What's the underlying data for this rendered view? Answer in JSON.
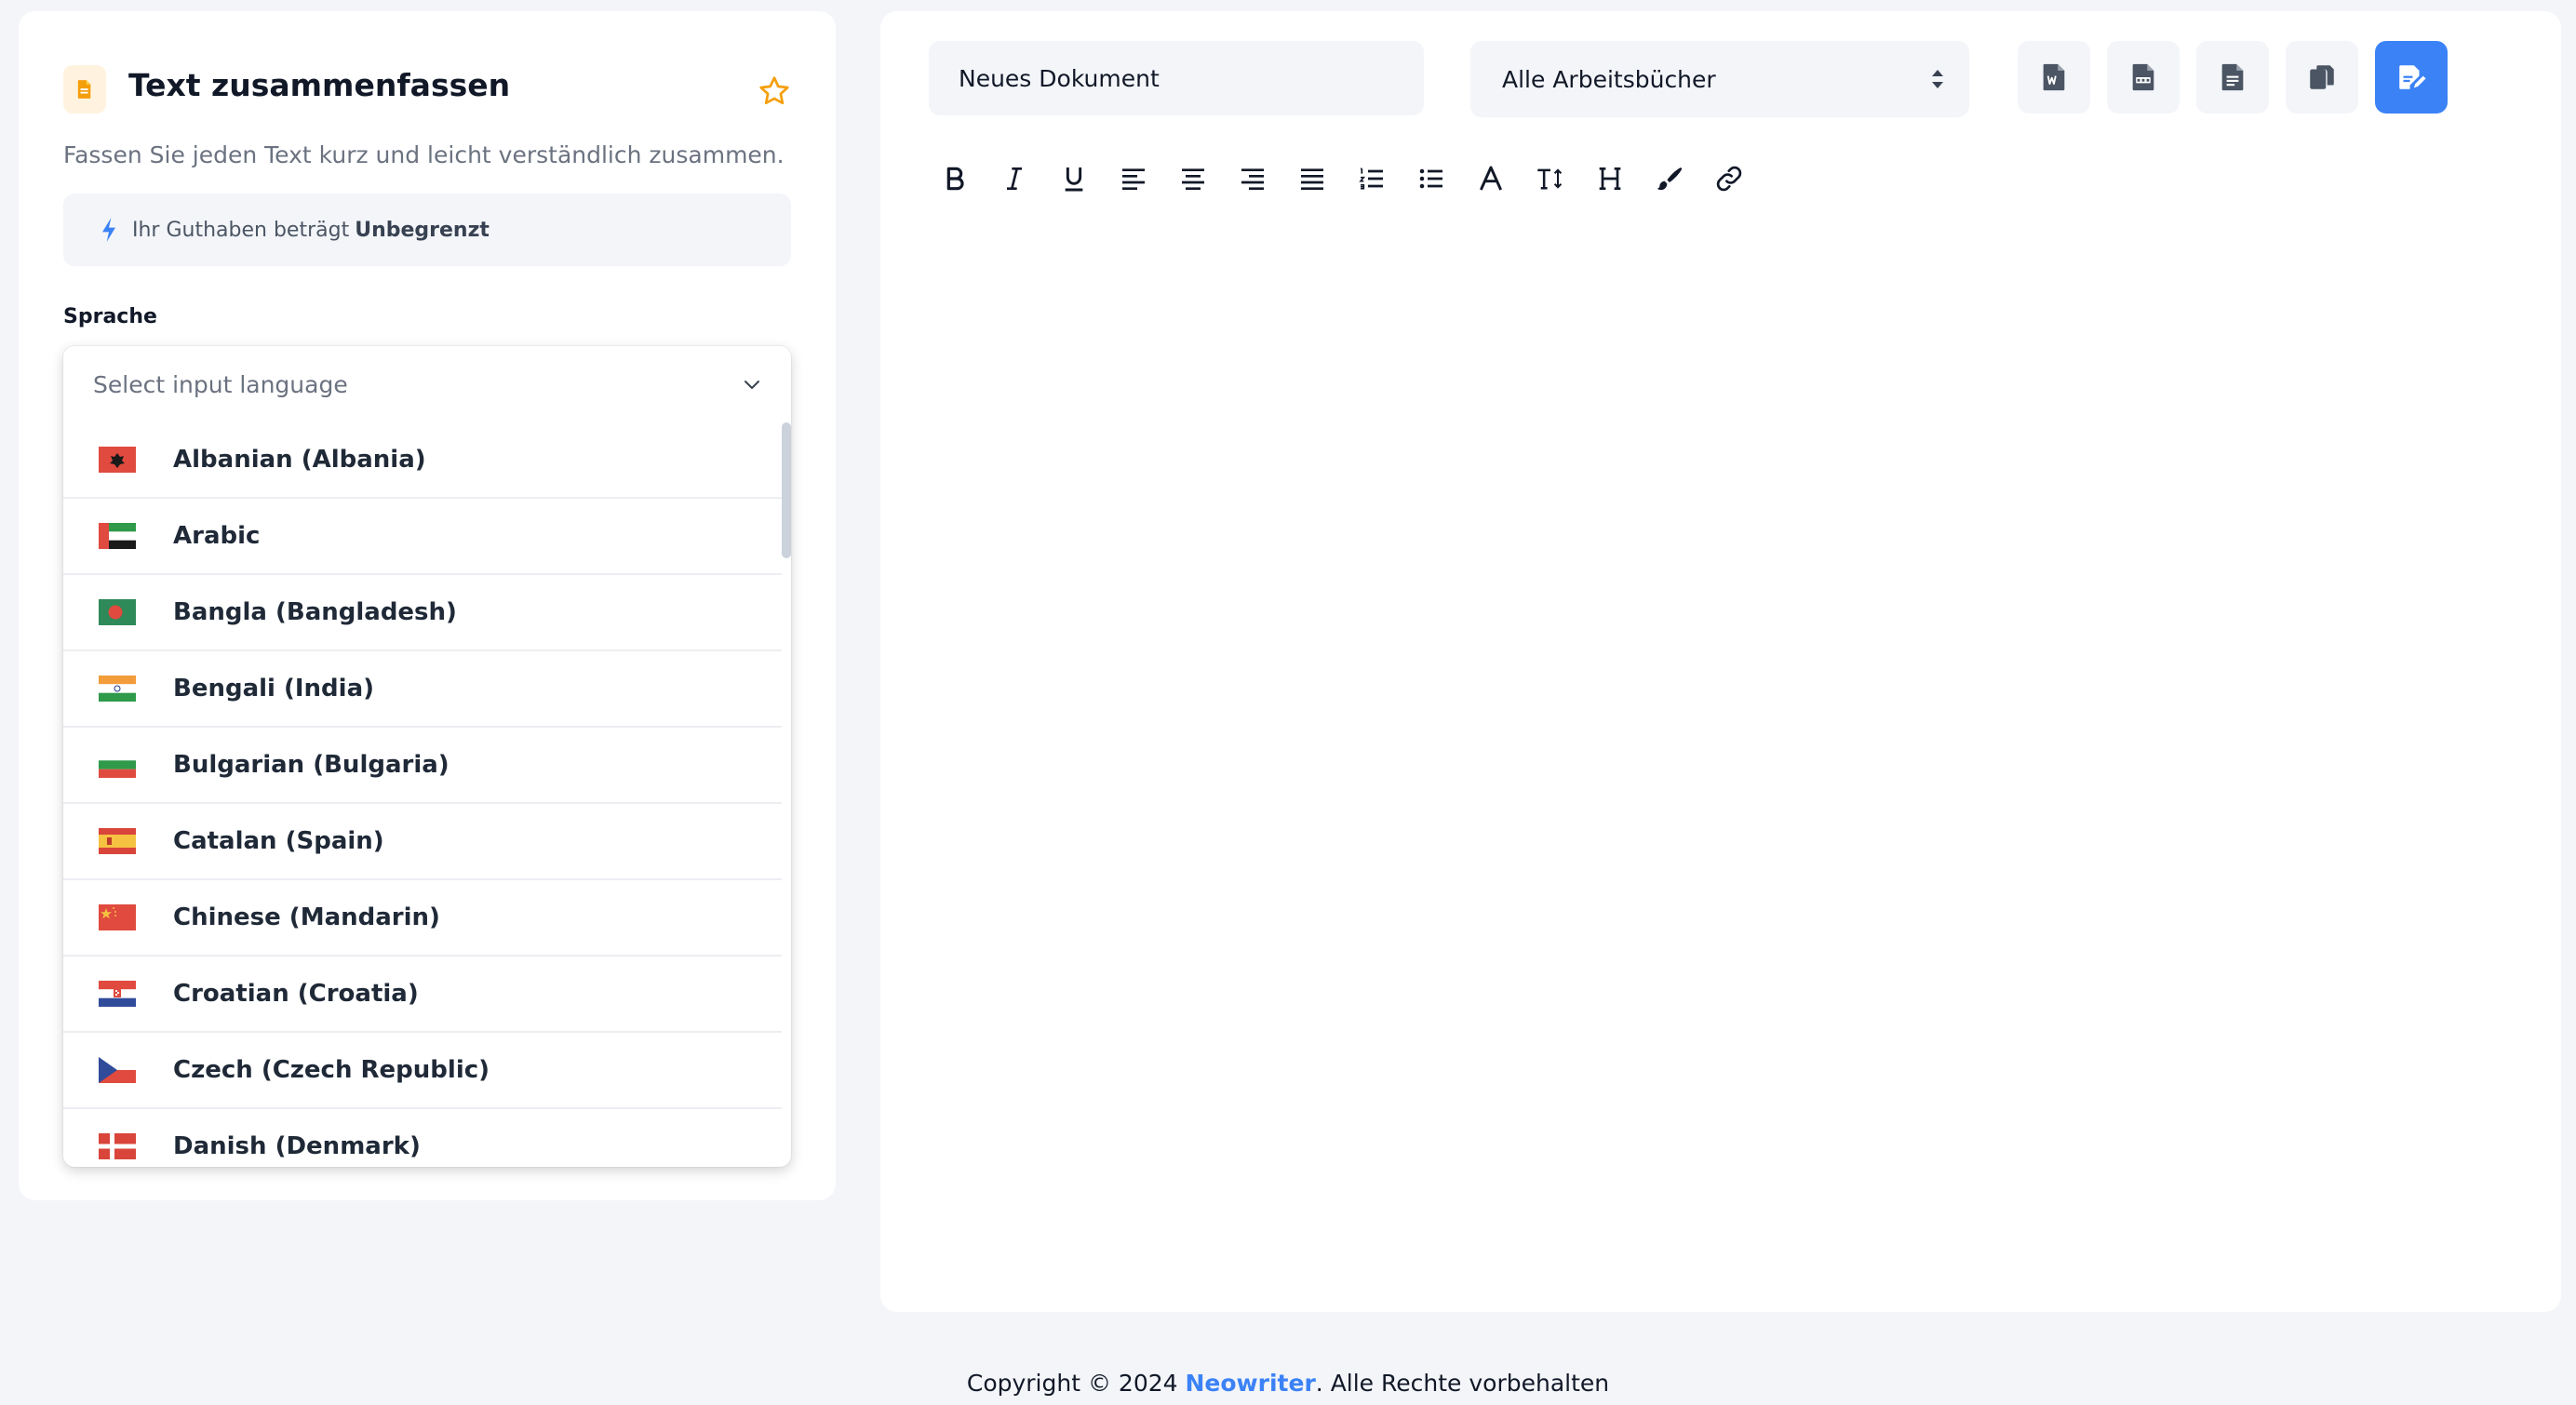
{
  "tool": {
    "title": "Text zusammenfassen",
    "description": "Fassen Sie jeden Text kurz und leicht verständlich zusammen.",
    "icon": "document-icon"
  },
  "credit": {
    "prefix": "Ihr Guthaben beträgt",
    "value": "Unbegrenzt",
    "icon": "bolt-icon"
  },
  "language": {
    "label": "Sprache",
    "placeholder": "Select input language",
    "options": [
      {
        "label": "Albanian (Albania)",
        "flag": "al"
      },
      {
        "label": "Arabic",
        "flag": "ae"
      },
      {
        "label": "Bangla (Bangladesh)",
        "flag": "bd"
      },
      {
        "label": "Bengali (India)",
        "flag": "in"
      },
      {
        "label": "Bulgarian (Bulgaria)",
        "flag": "bg"
      },
      {
        "label": "Catalan (Spain)",
        "flag": "es"
      },
      {
        "label": "Chinese (Mandarin)",
        "flag": "cn"
      },
      {
        "label": "Croatian (Croatia)",
        "flag": "hr"
      },
      {
        "label": "Czech (Czech Republic)",
        "flag": "cz"
      },
      {
        "label": "Danish (Denmark)",
        "flag": "dk"
      }
    ]
  },
  "document": {
    "name": "Neues Dokument",
    "workbook": "Alle Arbeitsbücher"
  },
  "actions": [
    "word-export-icon",
    "pdf-export-icon",
    "txt-export-icon",
    "copy-icon",
    "edit-document-icon"
  ],
  "toolbar": [
    "bold",
    "italic",
    "underline",
    "align-left",
    "align-center",
    "align-right",
    "align-justify",
    "ordered-list",
    "bullet-list",
    "font-color",
    "font-size",
    "heading",
    "brush",
    "link"
  ],
  "footer": {
    "prefix": "Copyright © 2024",
    "brand": "Neowriter",
    "suffix": ". Alle Rechte vorbehalten"
  },
  "colors": {
    "accent": "#3b82f6",
    "star": "#f59e0b",
    "tool_icon": "#f59e0b",
    "background": "#f3f5f9"
  }
}
